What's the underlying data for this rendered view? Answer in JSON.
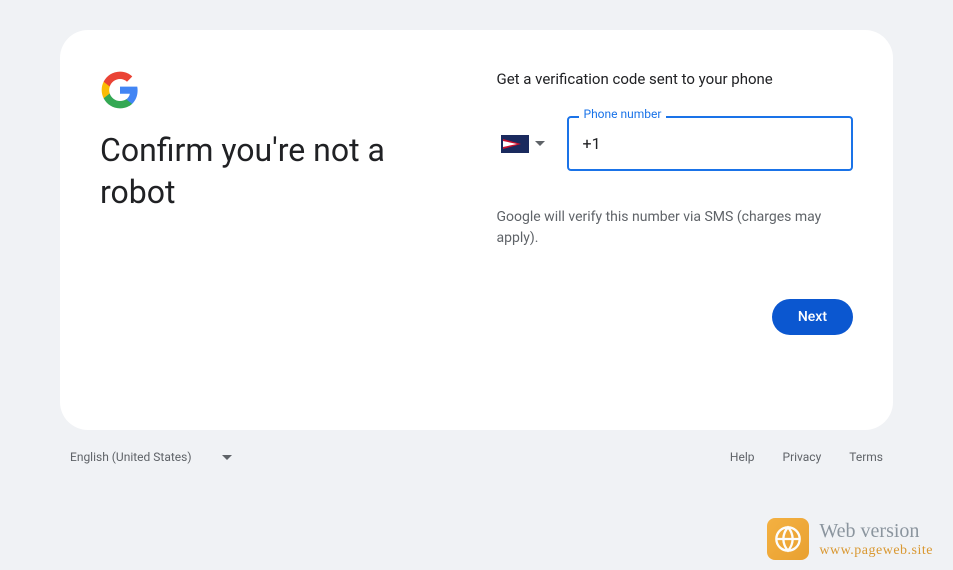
{
  "heading": "Confirm you're not a robot",
  "subheading": "Get a verification code sent to your phone",
  "phone": {
    "label": "Phone number",
    "value": "+1 "
  },
  "info_text": "Google will verify this number via SMS (charges may apply).",
  "next_button": "Next",
  "footer": {
    "language": "English (United States)",
    "links": {
      "help": "Help",
      "privacy": "Privacy",
      "terms": "Terms"
    }
  },
  "watermark": {
    "title": "Web version",
    "url": "www.pageweb.site"
  }
}
